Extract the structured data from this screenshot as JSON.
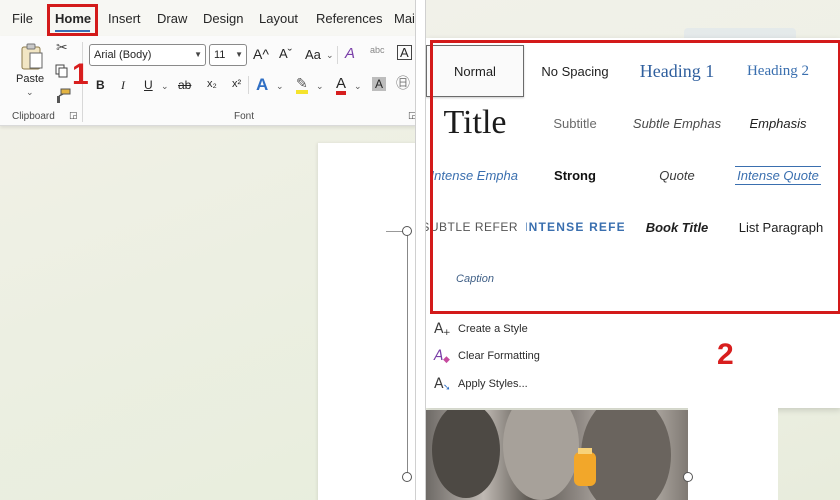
{
  "ribbon": {
    "tabs": [
      {
        "label": "File"
      },
      {
        "label": "Home"
      },
      {
        "label": "Insert"
      },
      {
        "label": "Draw"
      },
      {
        "label": "Design"
      },
      {
        "label": "Layout"
      },
      {
        "label": "References"
      },
      {
        "label": "Mai"
      }
    ],
    "clipboard": {
      "paste_label": "Paste",
      "group_label": "Clipboard"
    },
    "font": {
      "font_name": "Arial (Body)",
      "font_size": "11",
      "group_label": "Font",
      "grow": "A^",
      "shrink": "Aˇ",
      "change_case": "Aa",
      "bold": "B",
      "italic": "I",
      "underline": "U",
      "strikethrough": "ab",
      "subscript": "x₂",
      "superscript": "x²",
      "clear_format": "A",
      "text_effects": "A",
      "font_color": "A",
      "shading": "A"
    },
    "step_label": "1"
  },
  "styles_gallery": {
    "items": [
      {
        "label": "Normal"
      },
      {
        "label": "No Spacing"
      },
      {
        "label": "Heading 1"
      },
      {
        "label": "Heading 2"
      },
      {
        "label": "Title"
      },
      {
        "label": "Subtitle"
      },
      {
        "label": "Subtle Emphas"
      },
      {
        "label": "Emphasis"
      },
      {
        "label": "Intense Empha"
      },
      {
        "label": "Strong"
      },
      {
        "label": "Quote"
      },
      {
        "label": "Intense Quote"
      },
      {
        "label": "Subtle Refer"
      },
      {
        "label": "Intense Refe"
      },
      {
        "label": "Book Title"
      },
      {
        "label": "List Paragraph"
      },
      {
        "label": "Caption"
      }
    ],
    "menu": [
      {
        "label": "Create a Style"
      },
      {
        "label": "Clear Formatting"
      },
      {
        "label": "Apply Styles..."
      }
    ],
    "step_label": "2"
  },
  "colors": {
    "accent_red": "#d31a1a",
    "heading_blue": "#2f5f9e"
  }
}
